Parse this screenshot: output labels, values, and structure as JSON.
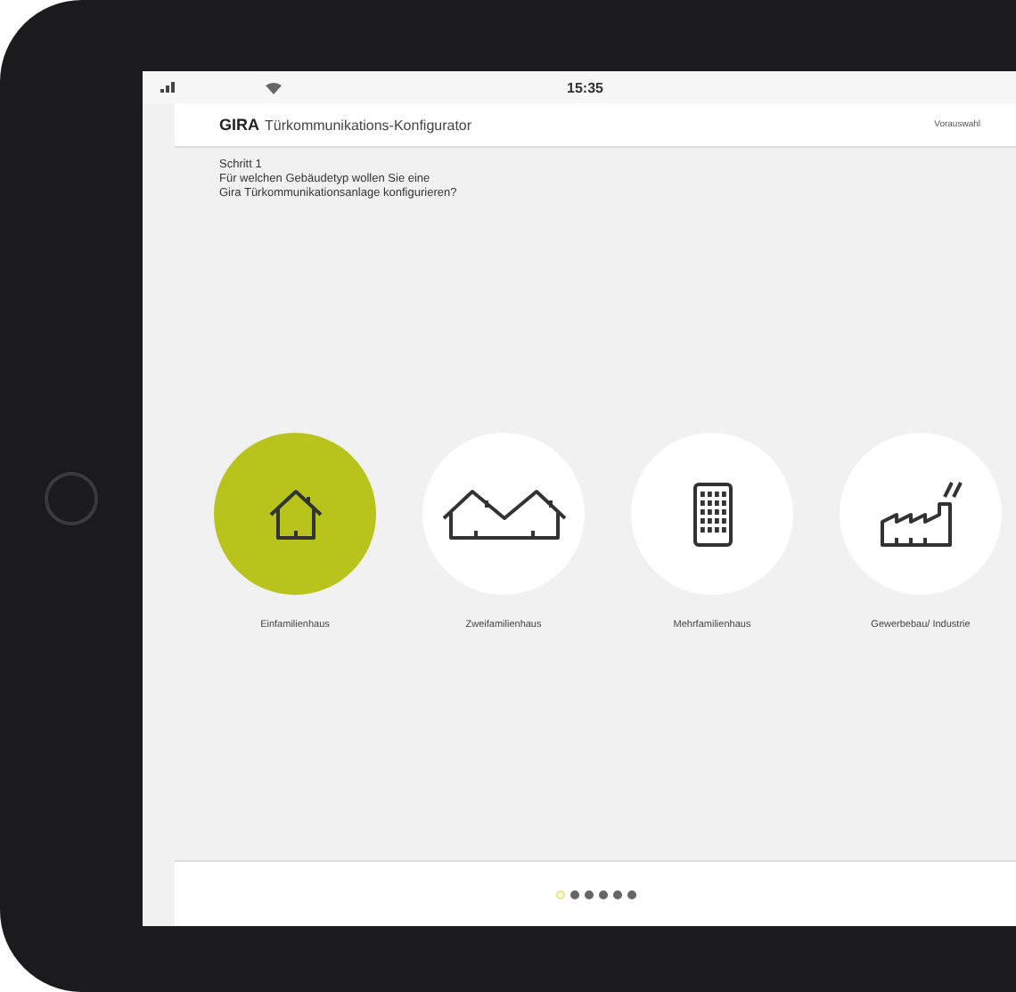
{
  "status_bar": {
    "time": "15:35"
  },
  "header": {
    "brand": "GIRA",
    "title": "Türkommunikations-Konfigurator",
    "steps": [
      {
        "label": "Vorauswahl",
        "selected": true
      }
    ]
  },
  "question": {
    "step": "Schritt 1",
    "text_line_1": "Für welchen Gebäudetyp wollen Sie eine",
    "text_line_2": "Gira Türkommunikationsanlage konfigurieren?"
  },
  "building_types": [
    {
      "kind": "house",
      "label": "Einfamilienhaus",
      "selected": true
    },
    {
      "kind": "double-house",
      "label": "Zweifamilienhaus",
      "selected": false
    },
    {
      "kind": "apartment",
      "label": "Mehrfamilienhaus",
      "selected": false
    },
    {
      "kind": "factory",
      "label": "Gewerbebau/ Industrie",
      "selected": false
    }
  ],
  "pager": [
    {
      "selected": true
    },
    {
      "selected": false
    },
    {
      "selected": false
    },
    {
      "selected": false
    },
    {
      "selected": false
    },
    {
      "selected": false
    }
  ]
}
